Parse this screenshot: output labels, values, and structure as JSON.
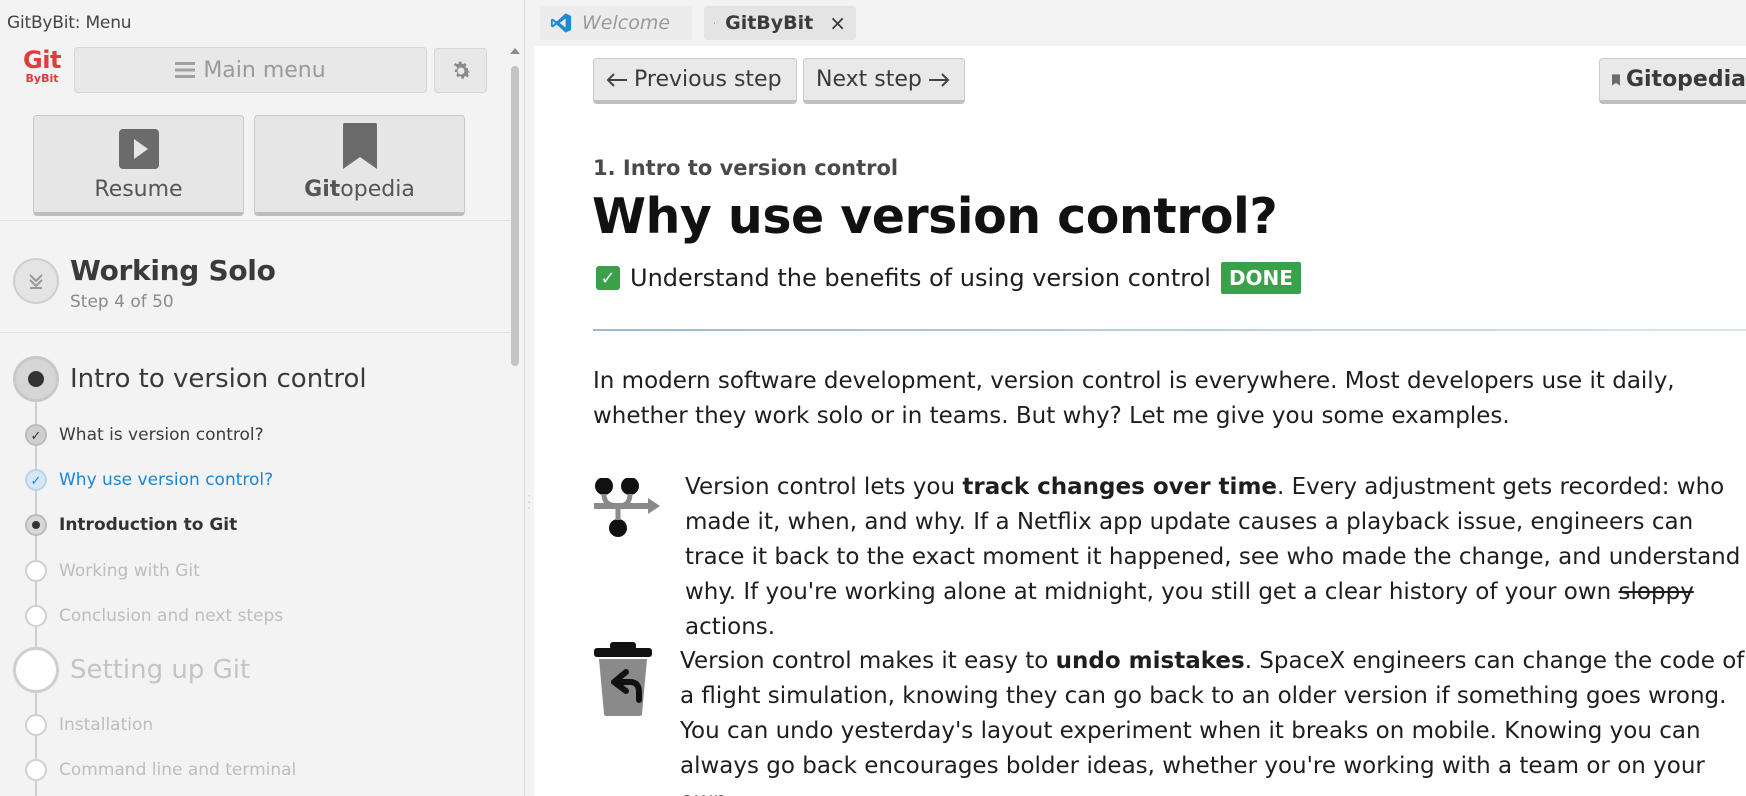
{
  "left_panel": {
    "title": "GitByBit: Menu",
    "logo": {
      "line1": "Git",
      "line2": "ByBit"
    },
    "main_menu_label": "Main menu",
    "resume_label": "Resume",
    "gitopedia_label_bold": "Git",
    "gitopedia_label_rest": "opedia",
    "course": {
      "title": "Working Solo",
      "step": "Step 4 of 50"
    },
    "sections": [
      {
        "label": "Intro to version control",
        "state": "active",
        "items": [
          {
            "label": "What is version control?",
            "state": "done"
          },
          {
            "label": "Why use version control?",
            "state": "current"
          },
          {
            "label": "Introduction to Git",
            "state": "next"
          },
          {
            "label": "Working with Git",
            "state": "locked"
          },
          {
            "label": "Conclusion and next steps",
            "state": "locked"
          }
        ]
      },
      {
        "label": "Setting up Git",
        "state": "locked",
        "items": [
          {
            "label": "Installation",
            "state": "locked"
          },
          {
            "label": "Command line and terminal",
            "state": "locked"
          }
        ]
      }
    ]
  },
  "tabs": [
    {
      "label": "Welcome",
      "icon": "vscode-icon",
      "active": false
    },
    {
      "label": "GitByBit",
      "icon": "play-icon",
      "active": true,
      "close": "×"
    }
  ],
  "nav": {
    "prev_label": "Previous step",
    "next_label": "Next step",
    "gitopedia_label": "Gitopedia"
  },
  "lesson": {
    "crumb": "1. Intro to version control",
    "title": "Why use version control?",
    "goal": "Understand the benefits of using version control",
    "goal_status": "DONE",
    "intro": "In modern software development, version control is everywhere. Most developers use it daily, whether they work solo or in teams. But why? Let me give you some examples.",
    "track": {
      "pre": "Version control lets you ",
      "bold": "track changes over time",
      "mid": ". Every adjustment gets recorded: who made it, when, and why. If a Netflix app update causes a playback issue, engineers can trace it back to the exact moment it happened, see who made the change, and understand why. If you're working alone at midnight, you still get a clear history of your own ",
      "struck": "sloppy",
      "post": " actions."
    },
    "undo": {
      "pre": "Version control makes it easy to ",
      "bold": "undo mistakes",
      "post": ". SpaceX engineers can change the code of a flight simulation, knowing they can go back to an older version if something goes wrong. You can undo yesterday's layout experiment when it breaks on mobile. Knowing you can always go back encourages bolder ideas, whether you're working with a team or on your own."
    }
  },
  "colors": {
    "accent_blue": "#1a86d9",
    "logo_red": "#e23b3b",
    "done_green": "#3aa14a"
  }
}
